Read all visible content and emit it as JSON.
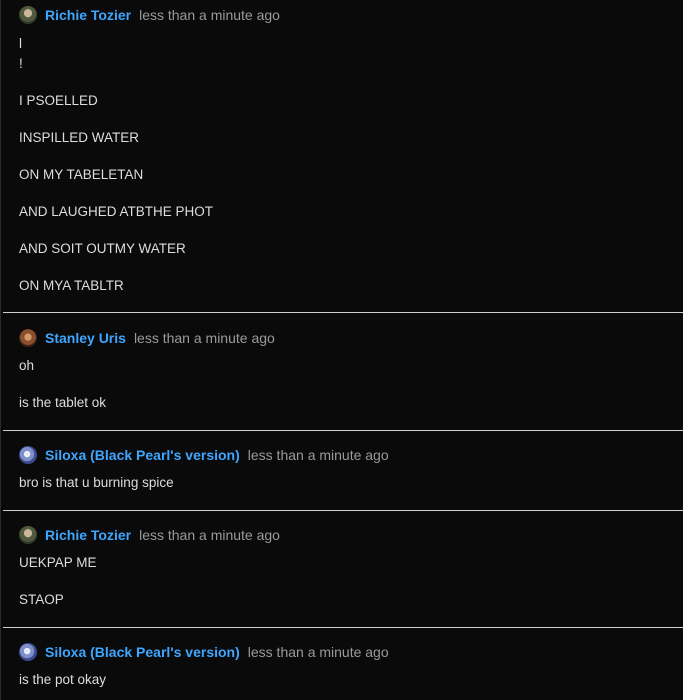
{
  "messages": [
    {
      "author": "Richie Tozier",
      "timestamp": "less than a minute ago",
      "avatar": "richie-avatar",
      "lines": [
        "l",
        "!",
        "I PSOELLED",
        "INSPILLED WATER",
        "ON MY TABELETAN",
        "AND LAUGHED ATBTHE PHOT",
        "AND SOIT OUTMY WATER",
        "ON MYA TABLTR"
      ]
    },
    {
      "author": "Stanley Uris",
      "timestamp": "less than a minute ago",
      "avatar": "stanley-avatar",
      "lines": [
        "oh",
        "is the tablet ok"
      ]
    },
    {
      "author": "Siloxa (Black Pearl's version)",
      "timestamp": "less than a minute ago",
      "avatar": "siloxa-avatar",
      "lines": [
        "bro is that u burning spice"
      ]
    },
    {
      "author": "Richie Tozier",
      "timestamp": "less than a minute ago",
      "avatar": "richie-avatar",
      "lines": [
        "UEKPAP ME",
        "STAOP"
      ]
    },
    {
      "author": "Siloxa (Black Pearl's version)",
      "timestamp": "less than a minute ago",
      "avatar": "siloxa-avatar",
      "lines": [
        "is the pot okay"
      ]
    }
  ],
  "colors": {
    "author": "#3ea6ff",
    "timestamp": "#9a9a9a",
    "background": "#0a0a0a",
    "text": "#dddddd"
  }
}
